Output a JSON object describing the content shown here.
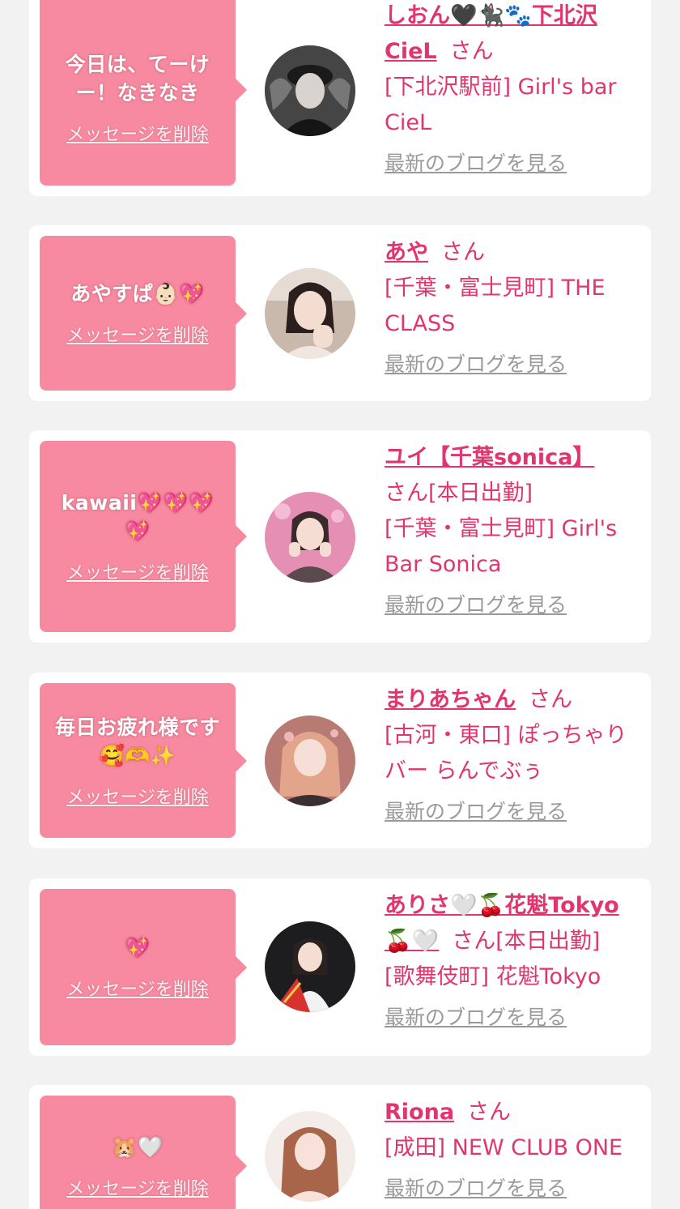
{
  "colors": {
    "background": "#f2f2f3",
    "card": "#ffffff",
    "bubble": "#f78aa0",
    "accent": "#e0356e",
    "link_gray": "#9a9a9a"
  },
  "common": {
    "delete_label": "メッセージを削除",
    "blog_label": "最新のブログを見る",
    "honorific": "さん"
  },
  "entries": [
    {
      "message": "今日は、てーけー！なきなき",
      "name": "しおん🖤🐈‍⬛🐾下北沢CieL",
      "status": "",
      "shop": "[下北沢駅前] Girl's bar CieL",
      "avatar_icon": "profile-photo-icon"
    },
    {
      "message": "あやすぱ👶🏻💖",
      "name": "あや",
      "status": "",
      "shop": "[千葉・富士見町] THE CLASS",
      "avatar_icon": "profile-photo-icon"
    },
    {
      "message": "kawaii💖💖💖💖",
      "name": "ユイ【千葉sonica】",
      "status": "[本日出勤]",
      "shop": "[千葉・富士見町] Girl's Bar Sonica",
      "avatar_icon": "profile-photo-icon"
    },
    {
      "message": "毎日お疲れ様です🥰🫶✨",
      "name": "まりあちゃん",
      "status": "",
      "shop": "[古河・東口] ぽっちゃりバー らんでぶぅ",
      "avatar_icon": "profile-photo-icon"
    },
    {
      "message": "💖",
      "name": "ありさ🤍🍒花魁Tokyo🍒🤍",
      "status": "[本日出勤]",
      "shop": "[歌舞伎町] 花魁Tokyo",
      "avatar_icon": "profile-photo-icon"
    },
    {
      "message": "🐹🤍",
      "name": "Riona",
      "status": "",
      "shop": "[成田] NEW CLUB ONE",
      "avatar_icon": "profile-photo-icon"
    }
  ]
}
